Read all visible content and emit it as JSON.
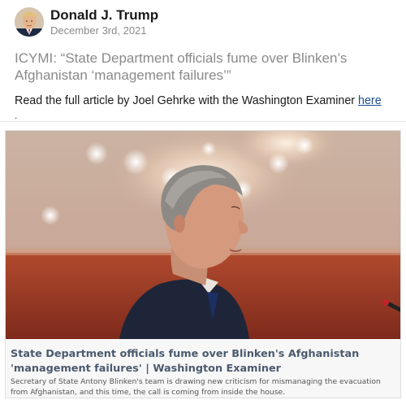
{
  "post": {
    "author_name": "Donald J. Trump",
    "date": "December 3rd, 2021",
    "headline": "ICYMI: “State Department officials fume over Blinken’s Afghanistan ‘management failures’”",
    "body_prefix": "Read the full article by Joel Gehrke with the Washington Examiner ",
    "link_text": "here",
    "trailing": "."
  },
  "link_preview": {
    "title": "State Department officials fume over Blinken's Afghanistan 'management failures' | Washington Examiner",
    "description": "Secretary of State Antony Blinken's team is drawing new criticism for mismanaging the evacuation from Afghanistan, and this time, the call is coming from inside the house."
  },
  "colors": {
    "link": "#1a4d8f",
    "preview_title": "#4a5a6e",
    "muted": "#8a8a8a"
  },
  "icons": {
    "avatar": "profile-photo",
    "preview_image": "photo-man-in-profile-chandelier"
  }
}
